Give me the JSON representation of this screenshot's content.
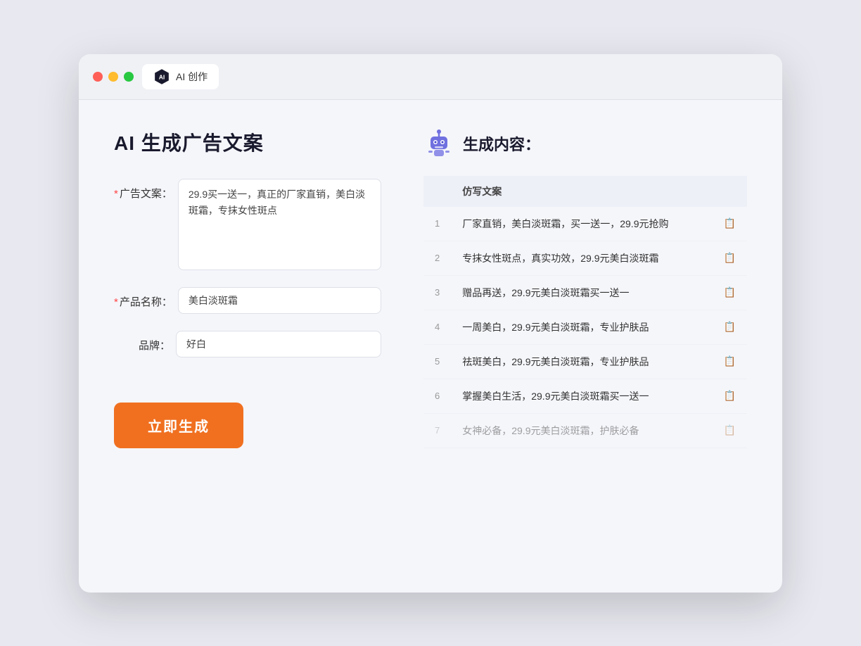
{
  "browser": {
    "tab_label": "AI 创作"
  },
  "left": {
    "title": "AI 生成广告文案",
    "form": {
      "ad_copy_label": "广告文案：",
      "ad_copy_required": "*",
      "ad_copy_value": "29.9买一送一，真正的厂家直销，美白淡斑霜，专抹女性斑点",
      "product_name_label": "产品名称：",
      "product_name_required": "*",
      "product_name_value": "美白淡斑霜",
      "brand_label": "品牌：",
      "brand_value": "好白"
    },
    "generate_button": "立即生成"
  },
  "right": {
    "title": "生成内容：",
    "table": {
      "column_header": "仿写文案",
      "rows": [
        {
          "num": "1",
          "text": "厂家直销，美白淡斑霜，买一送一，29.9元抢购",
          "muted": false
        },
        {
          "num": "2",
          "text": "专抹女性斑点，真实功效，29.9元美白淡斑霜",
          "muted": false
        },
        {
          "num": "3",
          "text": "赠品再送，29.9元美白淡斑霜买一送一",
          "muted": false
        },
        {
          "num": "4",
          "text": "一周美白，29.9元美白淡斑霜，专业护肤品",
          "muted": false
        },
        {
          "num": "5",
          "text": "祛斑美白，29.9元美白淡斑霜，专业护肤品",
          "muted": false
        },
        {
          "num": "6",
          "text": "掌握美白生活，29.9元美白淡斑霜买一送一",
          "muted": false
        },
        {
          "num": "7",
          "text": "女神必备，29.9元美白淡斑霜，护肤必备",
          "muted": true
        }
      ]
    }
  },
  "colors": {
    "accent_orange": "#f07020",
    "required_red": "#ff4444",
    "table_header_bg": "#eef0f8"
  }
}
